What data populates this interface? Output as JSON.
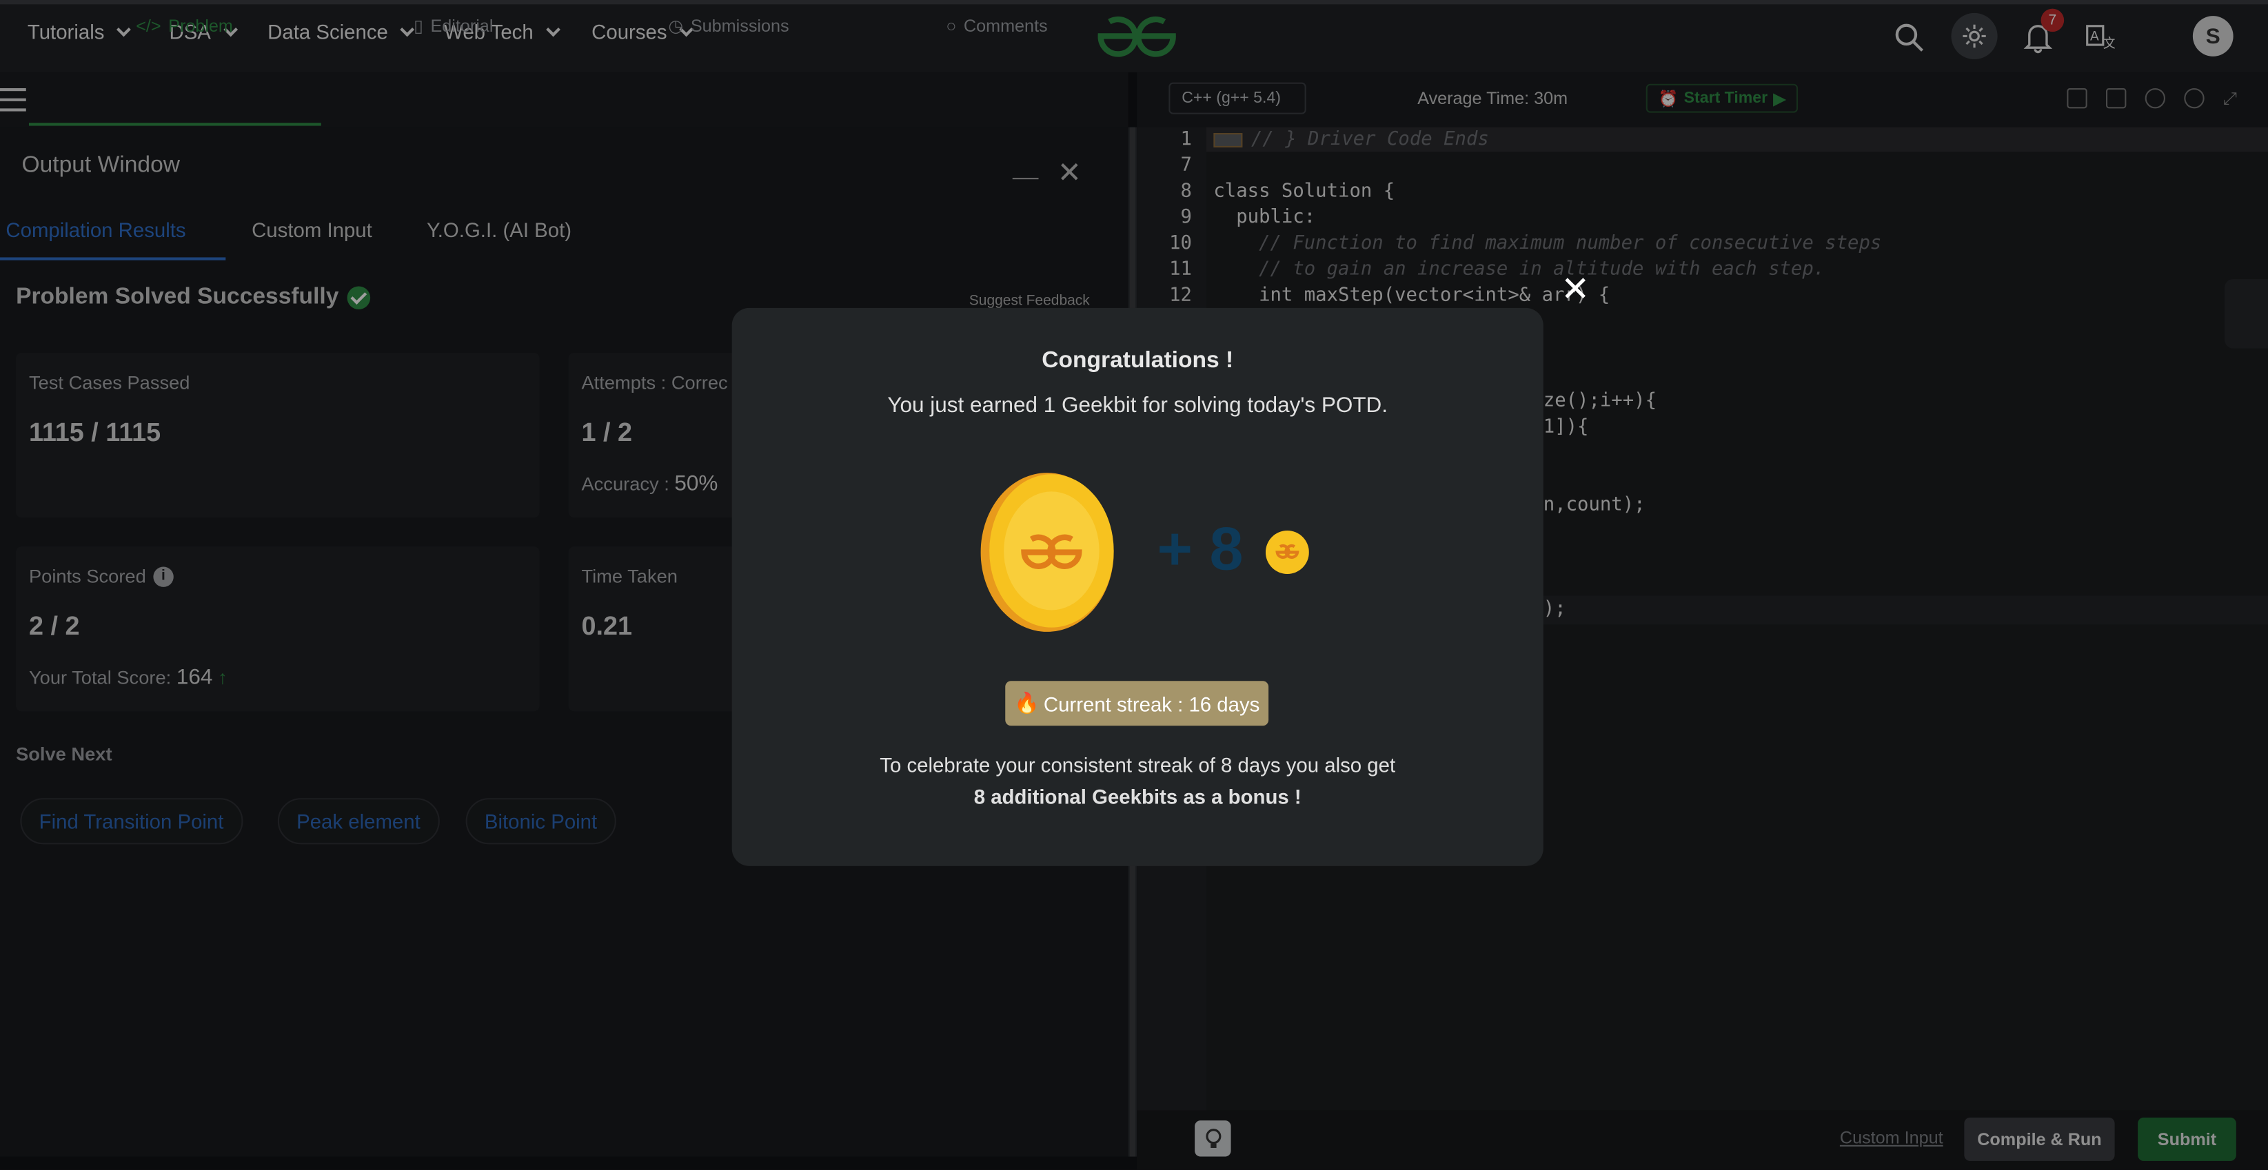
{
  "nav": {
    "items": [
      "Tutorials",
      "DSA",
      "Data Science",
      "Web Tech",
      "Courses"
    ],
    "notifications_count": "7",
    "avatar_initial": "S",
    "accent": "#2f8d46"
  },
  "left_tabs": {
    "problem": "Problem",
    "editorial": "Editorial",
    "submissions": "Submissions",
    "comments": "Comments"
  },
  "output_window": {
    "title": "Output Window",
    "tabs": [
      "Compilation Results",
      "Custom Input",
      "Y.O.G.I. (AI Bot)"
    ],
    "status": "Problem Solved Successfully",
    "suggest_feedback": "Suggest Feedback",
    "cards": {
      "test_cases_label": "Test Cases Passed",
      "test_cases_value": "1115 / 1115",
      "attempts_label": "Attempts : Correc",
      "attempts_value": "1 / 2",
      "accuracy_label": "Accuracy :",
      "accuracy_value": "50%",
      "points_label": "Points Scored",
      "points_value": "2 / 2",
      "total_score_label": "Your Total Score:",
      "total_score_value": "164",
      "time_label": "Time Taken",
      "time_value": "0.21"
    },
    "solve_next_label": "Solve Next",
    "solve_next": [
      "Find Transition Point",
      "Peak element",
      "Bitonic Point"
    ]
  },
  "editor": {
    "language": "C++ (g++ 5.4)",
    "average_time": "Average Time: 30m",
    "start_timer": "Start Timer",
    "line_numbers": [
      "1",
      "7",
      "8",
      "9",
      "10",
      "11",
      "12"
    ],
    "code_lines": [
      "// } Driver Code Ends",
      "",
      "class Solution {",
      "  public:",
      "    // Function to find maximum number of consecutive steps",
      "    // to gain an increase in altitude with each step.",
      "    int maxStep(vector<int>& arr) {"
    ],
    "hidden_fragments": [
      "ze();i++){",
      "1]){",
      "n,count);",
      ");"
    ],
    "custom_input": "Custom Input",
    "compile_run": "Compile & Run",
    "submit": "Submit"
  },
  "modal": {
    "title": "Congratulations !",
    "earned": "You just earned 1 Geekbit for solving today's POTD.",
    "bonus_count": "+ 8",
    "streak": "Current streak : 16 days",
    "celebrate_line1": "To celebrate your consistent streak of 8 days you also get",
    "celebrate_line2": "8 additional Geekbits as a bonus !"
  }
}
